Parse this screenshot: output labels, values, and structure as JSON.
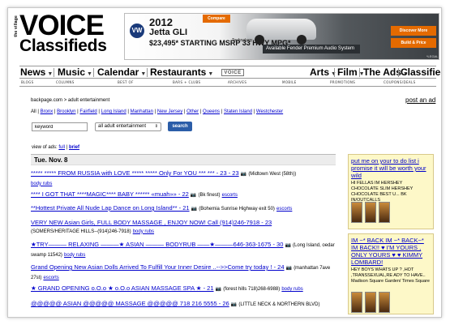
{
  "logo": {
    "village_text": "the village",
    "voice_text": "VOICE",
    "classifieds_text": "Classifieds"
  },
  "ad": {
    "brand_badge": "VW",
    "year": "2012",
    "model": "Jetta GLI",
    "price_line": "$23,495* STARTING MSRP  33 HWY MPG*",
    "compare_label": "Compare",
    "tech_label": "Technology",
    "audio_label": "Available Fender Premium Audio System",
    "btn_discover": "Discover More",
    "btn_build": "Build & Price",
    "legal": "*LEGAL",
    "accent_color": "#e46a00"
  },
  "nav": {
    "items": [
      {
        "label": "News"
      },
      {
        "label": "Music"
      },
      {
        "label": "Calendar"
      },
      {
        "label": "Restaurants"
      },
      {
        "label": "Arts"
      },
      {
        "label": "Film"
      },
      {
        "label": "The Ads"
      },
      {
        "label": "Classifieds"
      }
    ],
    "center_logo": "VOICE",
    "sub_items": [
      "BLOGS",
      "COLUMNS",
      "BEST OF",
      "BARS + CLUBS",
      "ARCHIVES",
      "MOBILE",
      "PROMOTIONS",
      "COUPONS/DEALS"
    ]
  },
  "breadcrumb": {
    "site": "backpage.com",
    "separator": " > ",
    "section": "adult entertainment"
  },
  "post_ad_label": "post an ad",
  "regions": {
    "items": [
      "All",
      "Bronx",
      "Brooklyn",
      "Fairfield",
      "Long Island",
      "Manhattan",
      "New Jersey",
      "Other",
      "Queens",
      "Staten Island",
      "Westchester"
    ]
  },
  "search": {
    "keyword_value": "keyword",
    "category_selected": "all adult entertainment",
    "button_label": "search"
  },
  "view_ads": {
    "label": "view of ads:",
    "full": "full",
    "separator": " | ",
    "brief": "brief"
  },
  "date_header": "Tue. Nov. 8",
  "listings": [
    {
      "title": "***** ***** FROM RUSSIA with LOVE ***** ***** Only For YOU *** *** - 23 - 23",
      "location": "(Midtown West (58th))",
      "category": "body rubs"
    },
    {
      "title": "**** I GOT THAT ****MAGIC**** BABY ****** «muah»» - 22",
      "location": "(Bk finest)",
      "category": "escorts"
    },
    {
      "title": "**Hottest Private All Nude Lap Dance on Long Island** - 21",
      "location": "(Bohemia Sunrise Highway exit 50)",
      "category": "escorts"
    },
    {
      "title": "VERY NEW Asian Girls, FULL BODY MASSAGE , ENJOY NOW! Call (914)246-7918 - 23",
      "location": "(SOMERS/HERITAGE HILLS--(914)246-7918)",
      "category": "body rubs"
    },
    {
      "title": "★TRY——— RELAXING ———★ ASIAN ——— BODYRUB ——★———646-363-1675 - 30",
      "location": "(Long Island, oedar swamp 11542)",
      "category": "body rubs"
    },
    {
      "title": "Grand Opening New Asian Dolls Arrived To Fulfill Your Inner Desire ..-->>Come try today ! - 24",
      "location": "(manhattan 7ave 27st)",
      "category": "escorts"
    },
    {
      "title": "★ GRAND OPENING o.O.o ★ o.O.o ASIAN MASSAGE SPA ★ - 21",
      "location": "(forest hills 718)268-6988)",
      "category": "body rubs"
    },
    {
      "title": "@@@@@ ASIAN @@@@@ MASSAGE @@@@@ 718 216 5555 - 26",
      "location": "(LITTLE NECK & NORTHERN BLVD)",
      "category": ""
    }
  ],
  "listing_icon": "📷",
  "side_ads": [
    {
      "title": "put me on your to do list i promise it will be worth your wild",
      "body": "HI FELLAS IM HERSHEY CHOCOLATE SLIM HERSHEY CHOCOLATE BEST U... BK IN/OUTCALLS"
    },
    {
      "title": "IM ~* BACK IM ~* BACK~* IM BACK!! ♥ I'M YOURS , ONLY YOURS ♥ ♥ KIMMY LOMBARD!",
      "body": "HEY BOYS WHATS UP ? ,HOT ,TRANSSEXUAL,RE ADY TO HAVE.. Madison Square Garden/ Times Square"
    }
  ],
  "colors": {
    "link": "#0000cc",
    "side_ad_bg": "#fdf8c8",
    "date_bar_bg": "#ececec",
    "search_button": "#2b5da8"
  }
}
